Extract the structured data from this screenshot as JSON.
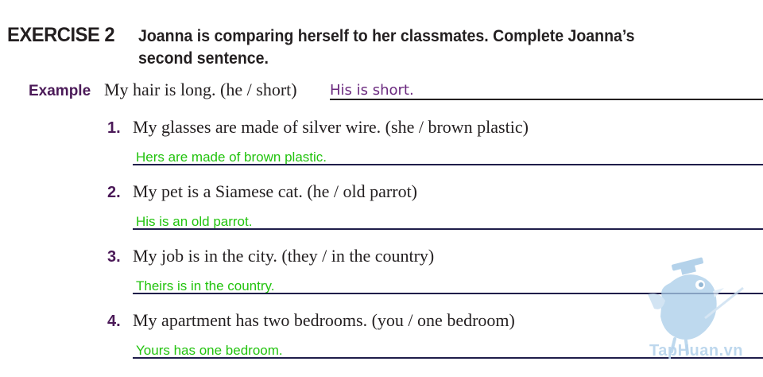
{
  "exercise": {
    "label": "EXERCISE 2",
    "instructions": "Joanna is comparing herself to her classmates. Complete Joanna’s second sentence."
  },
  "example": {
    "label": "Example",
    "sentence": "My hair is long. (he / short)",
    "answer": "His is short."
  },
  "items": [
    {
      "number": "1.",
      "sentence": "My glasses are made of silver wire. (she / brown plastic)",
      "answer": "Hers are made of brown plastic."
    },
    {
      "number": "2.",
      "sentence": "My pet is a Siamese cat. (he / old parrot)",
      "answer": "His is an old parrot."
    },
    {
      "number": "3.",
      "sentence": "My job is in the city. (they / in the country)",
      "answer": "Theirs is in the country."
    },
    {
      "number": "4.",
      "sentence": "My apartment has two bedrooms. (you / one bedroom)",
      "answer": "Yours has one bedroom."
    }
  ],
  "watermark": {
    "text": "TapHuan.vn",
    "icon": "bird-graduate-icon"
  },
  "colors": {
    "number": "#4b1a58",
    "example_answer": "#6b2a7f",
    "answer": "#22c30e",
    "rule": "#1f1d4a",
    "watermark": "#b6d3ec"
  }
}
